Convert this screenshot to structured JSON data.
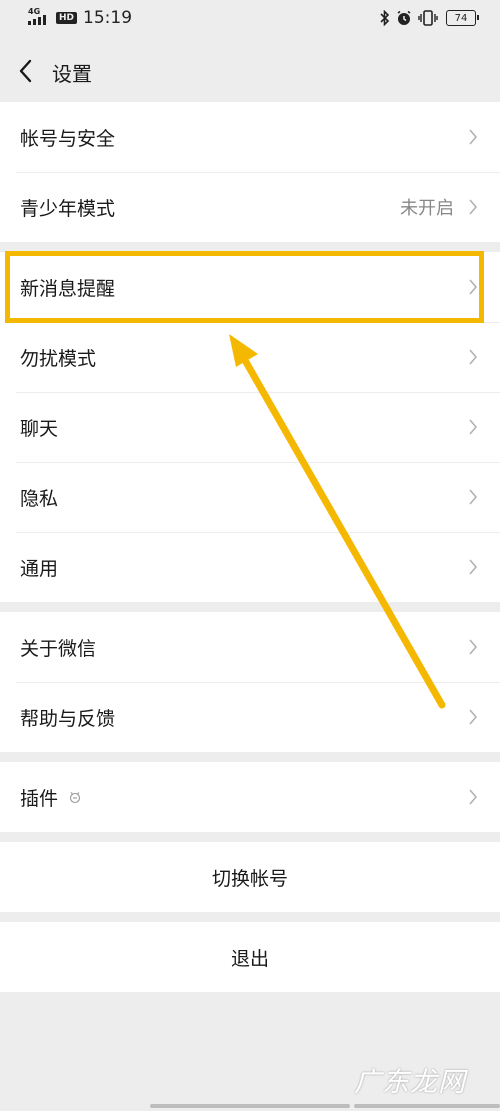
{
  "status_bar": {
    "network": "4G",
    "hd": "HD",
    "time": "15:19",
    "battery": "74"
  },
  "header": {
    "title": "设置"
  },
  "groups": [
    {
      "items": [
        {
          "label": "帐号与安全"
        },
        {
          "label": "青少年模式",
          "value": "未开启"
        }
      ]
    },
    {
      "items": [
        {
          "label": "新消息提醒"
        },
        {
          "label": "勿扰模式"
        },
        {
          "label": "聊天"
        },
        {
          "label": "隐私"
        },
        {
          "label": "通用"
        }
      ]
    },
    {
      "items": [
        {
          "label": "关于微信"
        },
        {
          "label": "帮助与反馈"
        }
      ]
    },
    {
      "items": [
        {
          "label": "插件"
        }
      ]
    }
  ],
  "actions": {
    "switch_account": "切换帐号",
    "logout": "退出"
  },
  "annotation": {
    "color": "#f5b800"
  },
  "watermark": "广东龙网"
}
